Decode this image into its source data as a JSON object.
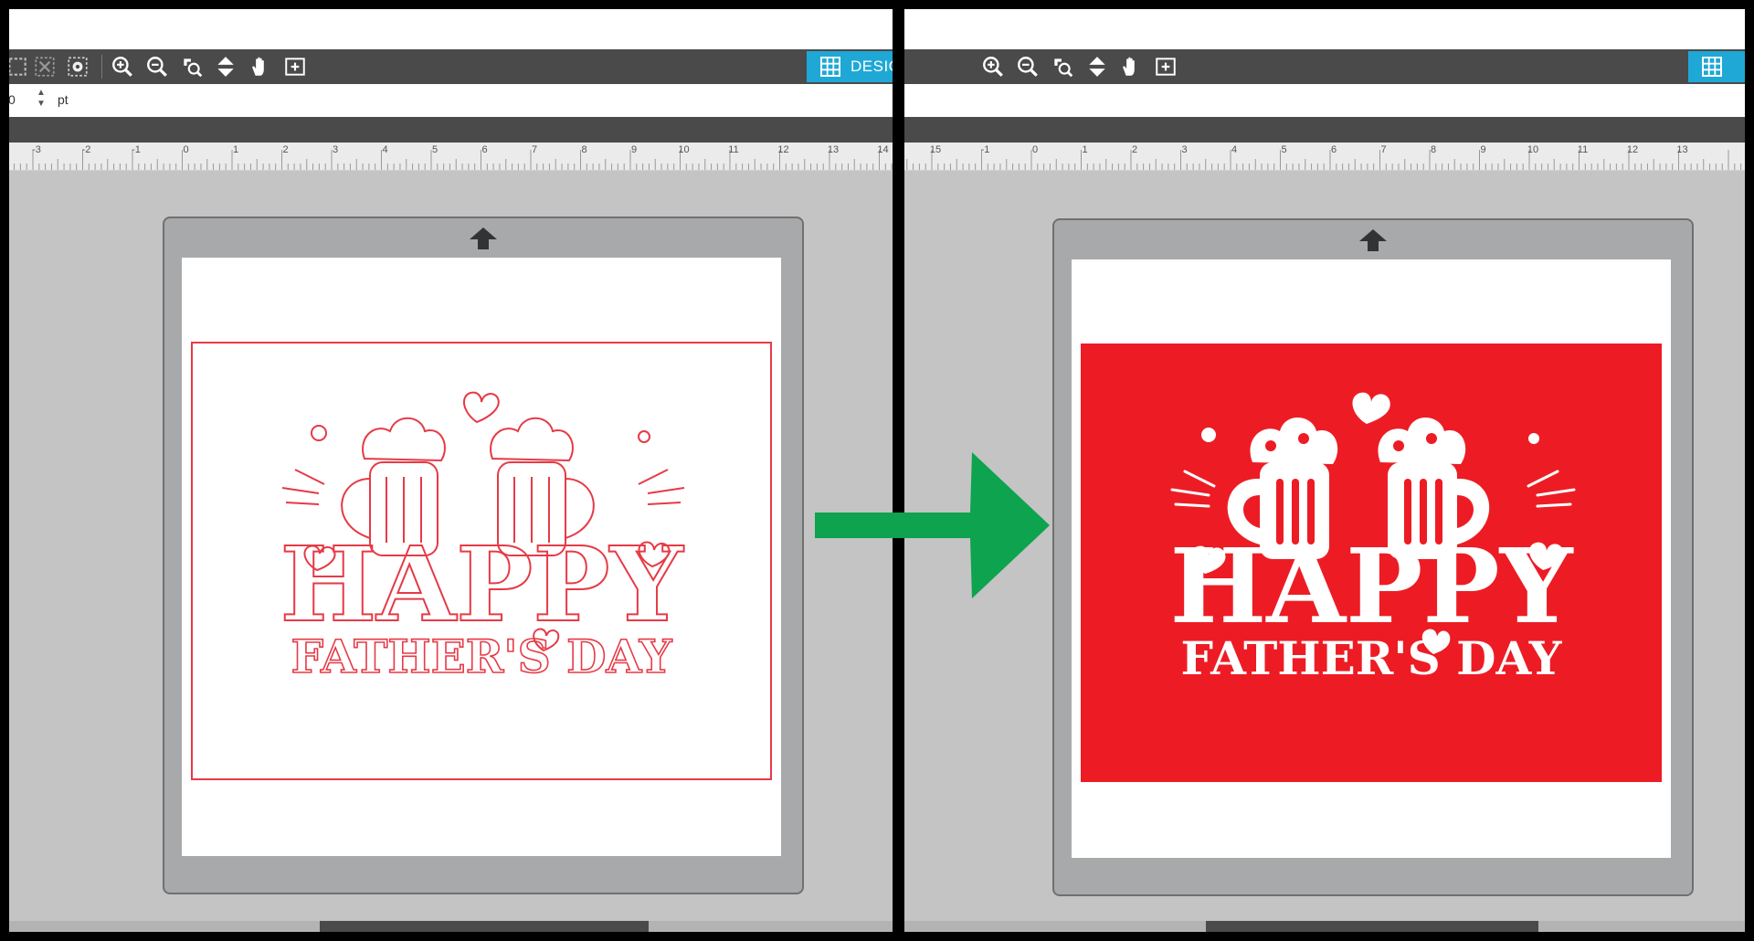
{
  "left_panel": {
    "design_tab_label": "DESIGN",
    "line_width_value": "0",
    "line_width_unit": "pt",
    "ruler_ticks": [
      "-3",
      "-2",
      "-1",
      "0",
      "1",
      "2",
      "3",
      "4",
      "5",
      "6",
      "7",
      "8",
      "9",
      "10",
      "11",
      "12",
      "13",
      "14"
    ],
    "design": {
      "title": "HAPPY",
      "subtitle": "FATHER'S DAY",
      "style": "outline",
      "line_color": "#e63a46"
    }
  },
  "right_panel": {
    "ruler_ticks": [
      "15",
      "-1",
      "0",
      "1",
      "2",
      "3",
      "4",
      "5",
      "6",
      "7",
      "8",
      "9",
      "10",
      "11",
      "12",
      "13"
    ],
    "design": {
      "title": "HAPPY",
      "subtitle": "FATHER'S DAY",
      "style": "filled",
      "fill_color": "#ed1c24"
    }
  },
  "colors": {
    "toolbar": "#4a4a4a",
    "design_tab": "#1fa8d6",
    "mat": "#a8a9ab",
    "arrow": "#0da34f"
  },
  "icons": {
    "toolbar": [
      "zoom-in-icon",
      "zoom-out-icon",
      "zoom-selection-icon",
      "fit-to-page-icon",
      "pan-hand-icon",
      "add-page-icon"
    ],
    "left_extra": [
      "select-all-icon",
      "deselect-icon",
      "view-options-icon"
    ],
    "mat_top": "feed-arrow-icon",
    "between_panels": "right-arrow-icon"
  }
}
